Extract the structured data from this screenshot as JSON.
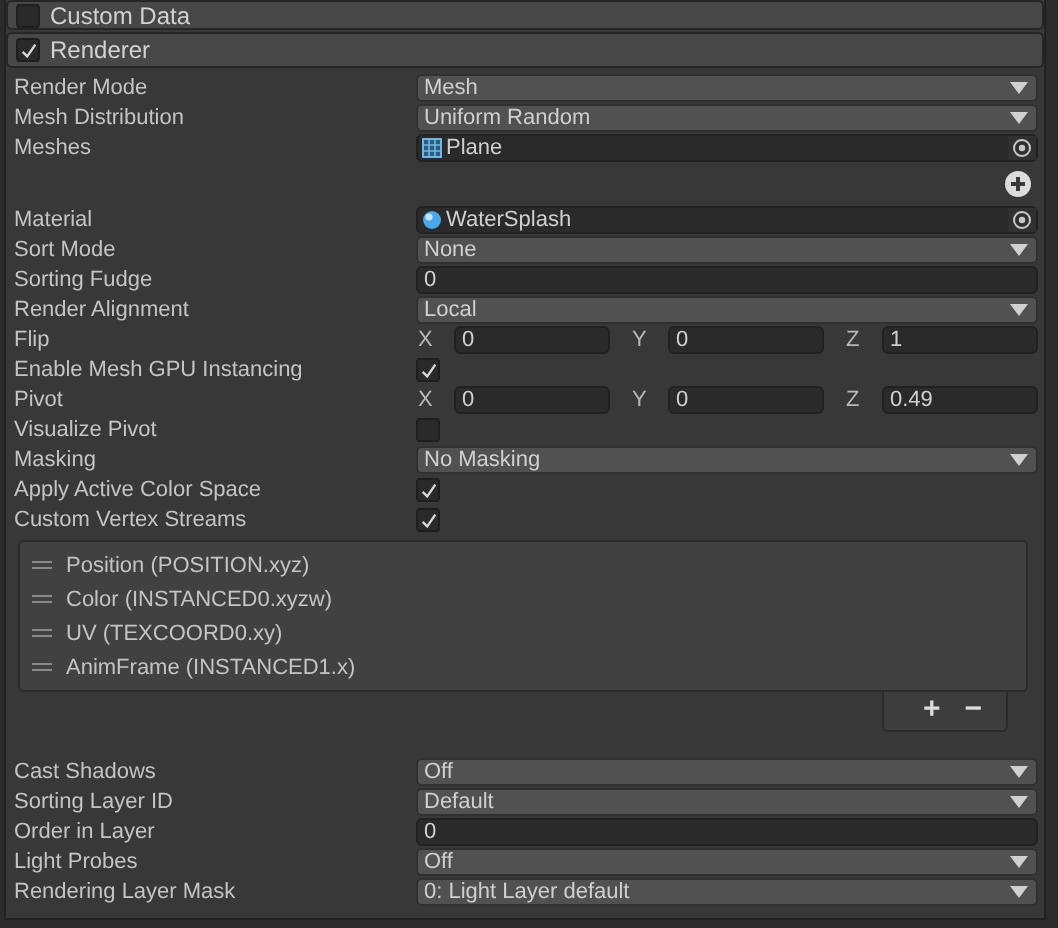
{
  "sections": [
    {
      "title": "Custom Data",
      "enabled": false
    },
    {
      "title": "Renderer",
      "enabled": true,
      "rows": [
        {
          "kind": "dropdown",
          "label": "Render Mode",
          "value": "Mesh"
        },
        {
          "kind": "dropdown",
          "label": "Mesh Distribution",
          "value": "Uniform Random"
        },
        {
          "kind": "mesh",
          "label": "Meshes",
          "value": "Plane"
        },
        {
          "kind": "add"
        },
        {
          "kind": "material",
          "label": "Material",
          "value": "WaterSplash"
        },
        {
          "kind": "dropdown",
          "label": "Sort Mode",
          "value": "None"
        },
        {
          "kind": "field",
          "label": "Sorting Fudge",
          "value": "0"
        },
        {
          "kind": "dropdown",
          "label": "Render Alignment",
          "value": "Local"
        },
        {
          "kind": "vector",
          "label": "Flip",
          "components": [
            {
              "axis": "X",
              "value": "0"
            },
            {
              "axis": "Y",
              "value": "0"
            },
            {
              "axis": "Z",
              "value": "1"
            }
          ]
        },
        {
          "kind": "checkbox",
          "label": "Enable Mesh GPU Instancing",
          "checked": true
        },
        {
          "kind": "vector",
          "label": "Pivot",
          "components": [
            {
              "axis": "X",
              "value": "0"
            },
            {
              "axis": "Y",
              "value": "0"
            },
            {
              "axis": "Z",
              "value": "0.49"
            }
          ]
        },
        {
          "kind": "checkbox",
          "label": "Visualize Pivot",
          "checked": false
        },
        {
          "kind": "dropdown",
          "label": "Masking",
          "value": "No Masking"
        },
        {
          "kind": "checkbox",
          "label": "Apply Active Color Space",
          "checked": true
        },
        {
          "kind": "checkbox",
          "label": "Custom Vertex Streams",
          "checked": true
        },
        {
          "kind": "streams",
          "items": [
            "Position (POSITION.xyz)",
            "Color (INSTANCED0.xyzw)",
            "UV (TEXCOORD0.xy)",
            "AnimFrame (INSTANCED1.x)"
          ],
          "buttons": [
            "+",
            "−"
          ]
        },
        {
          "kind": "dropdown",
          "label": "Cast Shadows",
          "value": "Off"
        },
        {
          "kind": "dropdown",
          "label": "Sorting Layer ID",
          "value": "Default"
        },
        {
          "kind": "field",
          "label": "Order in Layer",
          "value": "0"
        },
        {
          "kind": "dropdown",
          "label": "Light Probes",
          "value": "Off"
        },
        {
          "kind": "dropdown",
          "label": "Rendering Layer Mask",
          "value": "0: Light Layer default"
        }
      ]
    }
  ]
}
